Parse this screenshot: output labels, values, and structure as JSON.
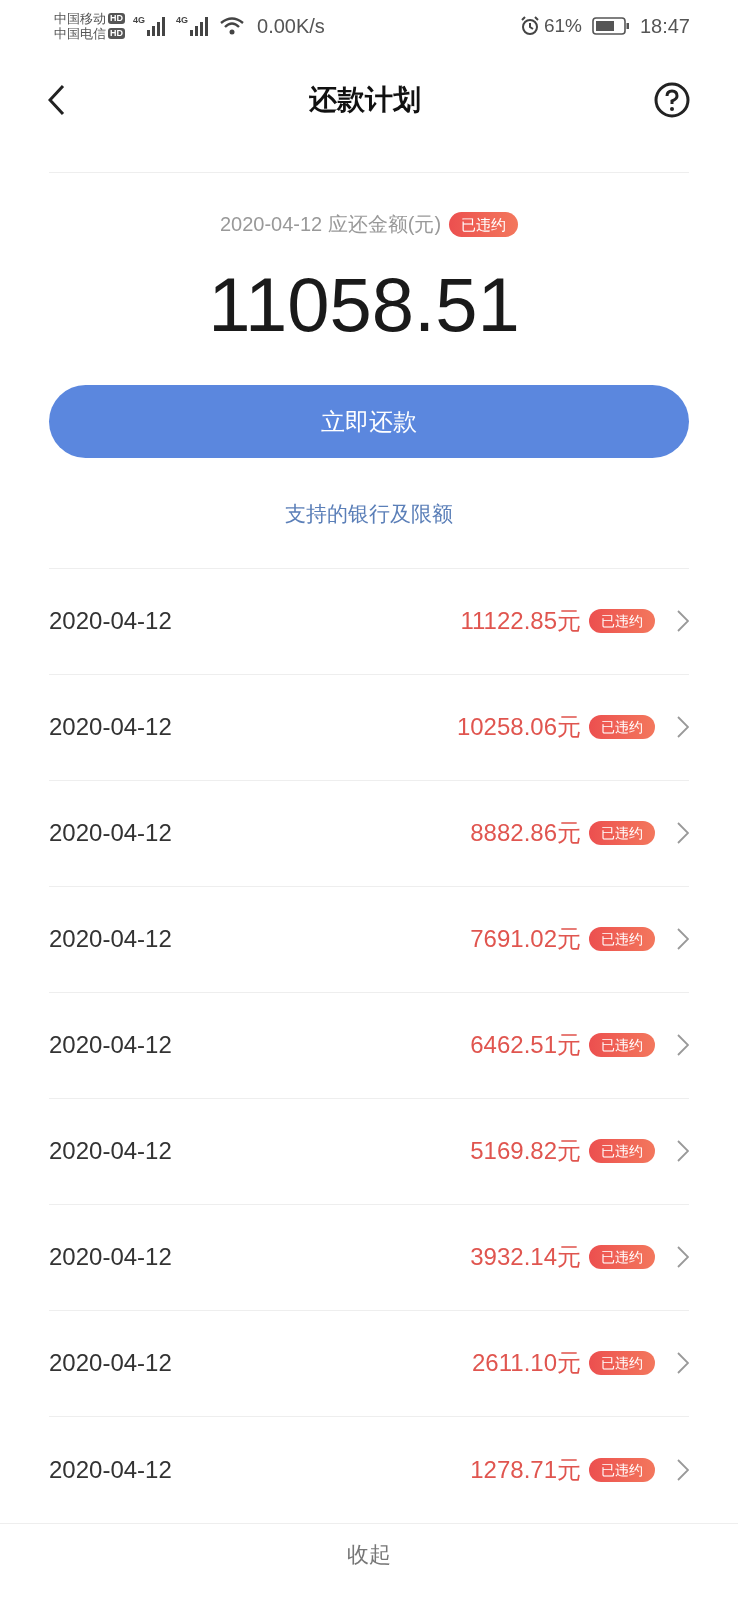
{
  "status_bar": {
    "carriers": [
      {
        "name": "中国移动",
        "badge": "HD"
      },
      {
        "name": "中国电信",
        "badge": "HD"
      }
    ],
    "network_labels": [
      "4G",
      "4G"
    ],
    "speed": "0.00K/s",
    "battery_percent": "61%",
    "time": "18:47"
  },
  "header": {
    "title": "还款计划"
  },
  "summary": {
    "caption": "2020-04-12 应还金额(元)",
    "badge": "已违约",
    "amount": "11058.51"
  },
  "pay_button": "立即还款",
  "banks_link": "支持的银行及限额",
  "rows": [
    {
      "date": "2020-04-12",
      "amount": "11122.85元",
      "badge": "已违约"
    },
    {
      "date": "2020-04-12",
      "amount": "10258.06元",
      "badge": "已违约"
    },
    {
      "date": "2020-04-12",
      "amount": "8882.86元",
      "badge": "已违约"
    },
    {
      "date": "2020-04-12",
      "amount": "7691.02元",
      "badge": "已违约"
    },
    {
      "date": "2020-04-12",
      "amount": "6462.51元",
      "badge": "已违约"
    },
    {
      "date": "2020-04-12",
      "amount": "5169.82元",
      "badge": "已违约"
    },
    {
      "date": "2020-04-12",
      "amount": "3932.14元",
      "badge": "已违约"
    },
    {
      "date": "2020-04-12",
      "amount": "2611.10元",
      "badge": "已违约"
    },
    {
      "date": "2020-04-12",
      "amount": "1278.71元",
      "badge": "已违约"
    }
  ],
  "collapse": "收起"
}
